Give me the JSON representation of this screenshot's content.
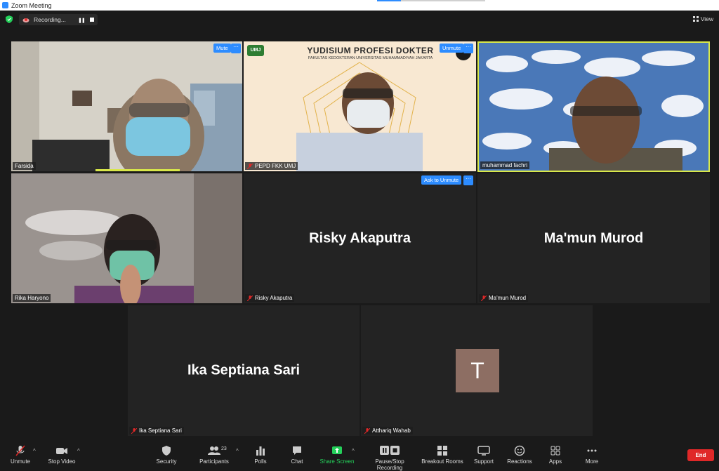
{
  "window": {
    "title": "Zoom Meeting"
  },
  "top": {
    "recording_label": "Recording...",
    "view_label": "View"
  },
  "tiles": {
    "farsida": {
      "name": "Farsida",
      "button": "Mute"
    },
    "pepd": {
      "name": "PEPD FKK UMJ",
      "button": "Unmute",
      "banner_title": "YUDISIUM PROFESI DOKTER",
      "banner_sub": "FAKULTAS KEDOKTERAN UNIVERSITAS MUHAMMADIYAH JAKARTA",
      "logo_text": "UMJ"
    },
    "fachri": {
      "name": "muhammad fachri"
    },
    "rika": {
      "name": "Rika Haryono"
    },
    "risky": {
      "name": "Risky Akaputra",
      "button": "Ask to Unmute"
    },
    "mamun": {
      "name": "Ma'mun Murod"
    },
    "ika": {
      "name": "Ika Septiana Sari"
    },
    "atthariq": {
      "name": "Atthariq Wahab",
      "initial": "T"
    }
  },
  "toolbar": {
    "unmute": "Unmute",
    "stop_video": "Stop Video",
    "security": "Security",
    "participants": "Participants",
    "participants_count": "23",
    "polls": "Polls",
    "chat": "Chat",
    "share_screen": "Share Screen",
    "pause_stop_recording": "Pause/Stop Recording",
    "breakout_rooms": "Breakout Rooms",
    "support": "Support",
    "reactions": "Reactions",
    "apps": "Apps",
    "more": "More",
    "end": "End"
  },
  "colors": {
    "accent": "#2d8cff",
    "active_speaker": "#d9e84a",
    "end": "#e02828",
    "share": "#24d05a",
    "avatar": "#8d6e63"
  }
}
